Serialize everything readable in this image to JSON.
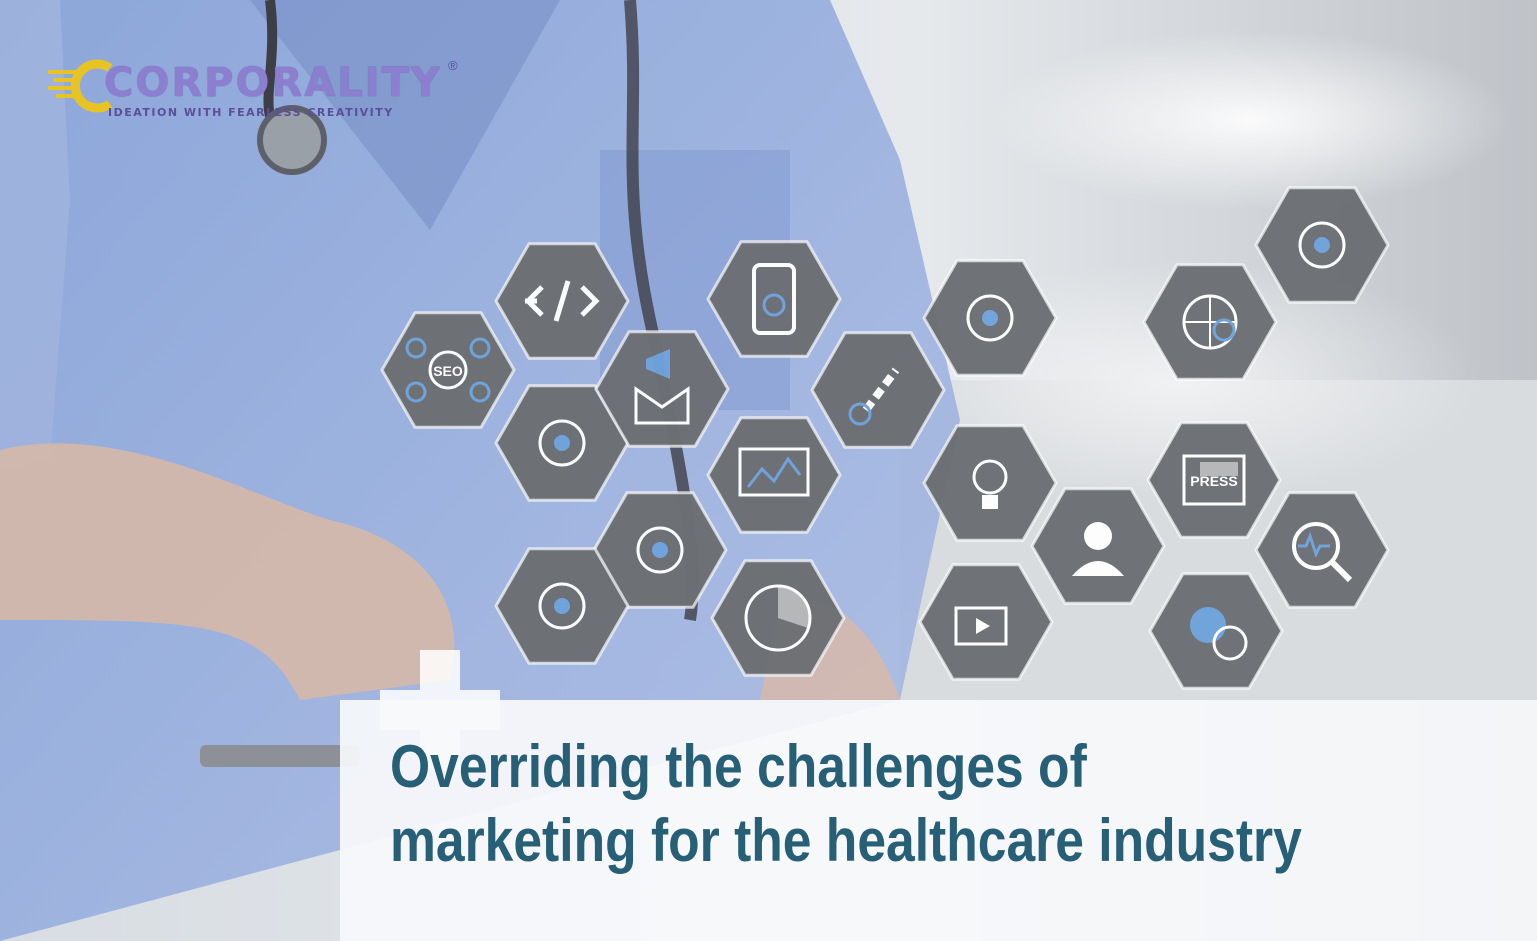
{
  "logo": {
    "wordmark": "CORPORALITY",
    "registered": "®",
    "tagline": "IDEATION WITH FEARLESS CREATIVITY"
  },
  "headline": {
    "line1": "Overriding the challenges of",
    "line2": "marketing for the healthcare industry"
  },
  "icons": [
    {
      "name": "seo-network-icon",
      "label": "SEO"
    },
    {
      "name": "code-icon"
    },
    {
      "name": "social-media-icon"
    },
    {
      "name": "email-marketing-icon"
    },
    {
      "name": "mobile-settings-icon"
    },
    {
      "name": "analytics-monitor-icon"
    },
    {
      "name": "global-network-user-icon"
    },
    {
      "name": "link-check-icon"
    },
    {
      "name": "notebook-edit-icon"
    },
    {
      "name": "pie-chart-icon"
    },
    {
      "name": "audience-icon"
    },
    {
      "name": "lightbulb-idea-icon"
    },
    {
      "name": "video-promotion-icon"
    },
    {
      "name": "support-agent-icon"
    },
    {
      "name": "global-search-icon"
    },
    {
      "name": "press-news-icon",
      "label": "PRESS"
    },
    {
      "name": "search-pulse-icon"
    },
    {
      "name": "like-chat-icon"
    },
    {
      "name": "social-megaphone-icon"
    }
  ],
  "colors": {
    "headline": "#275f77",
    "scrubs": "#8ea9dc",
    "hexagon": "#6c6f73",
    "icon_line": "#ffffff",
    "icon_accent": "#6fa3dc",
    "logo": "#8d7fd0"
  }
}
